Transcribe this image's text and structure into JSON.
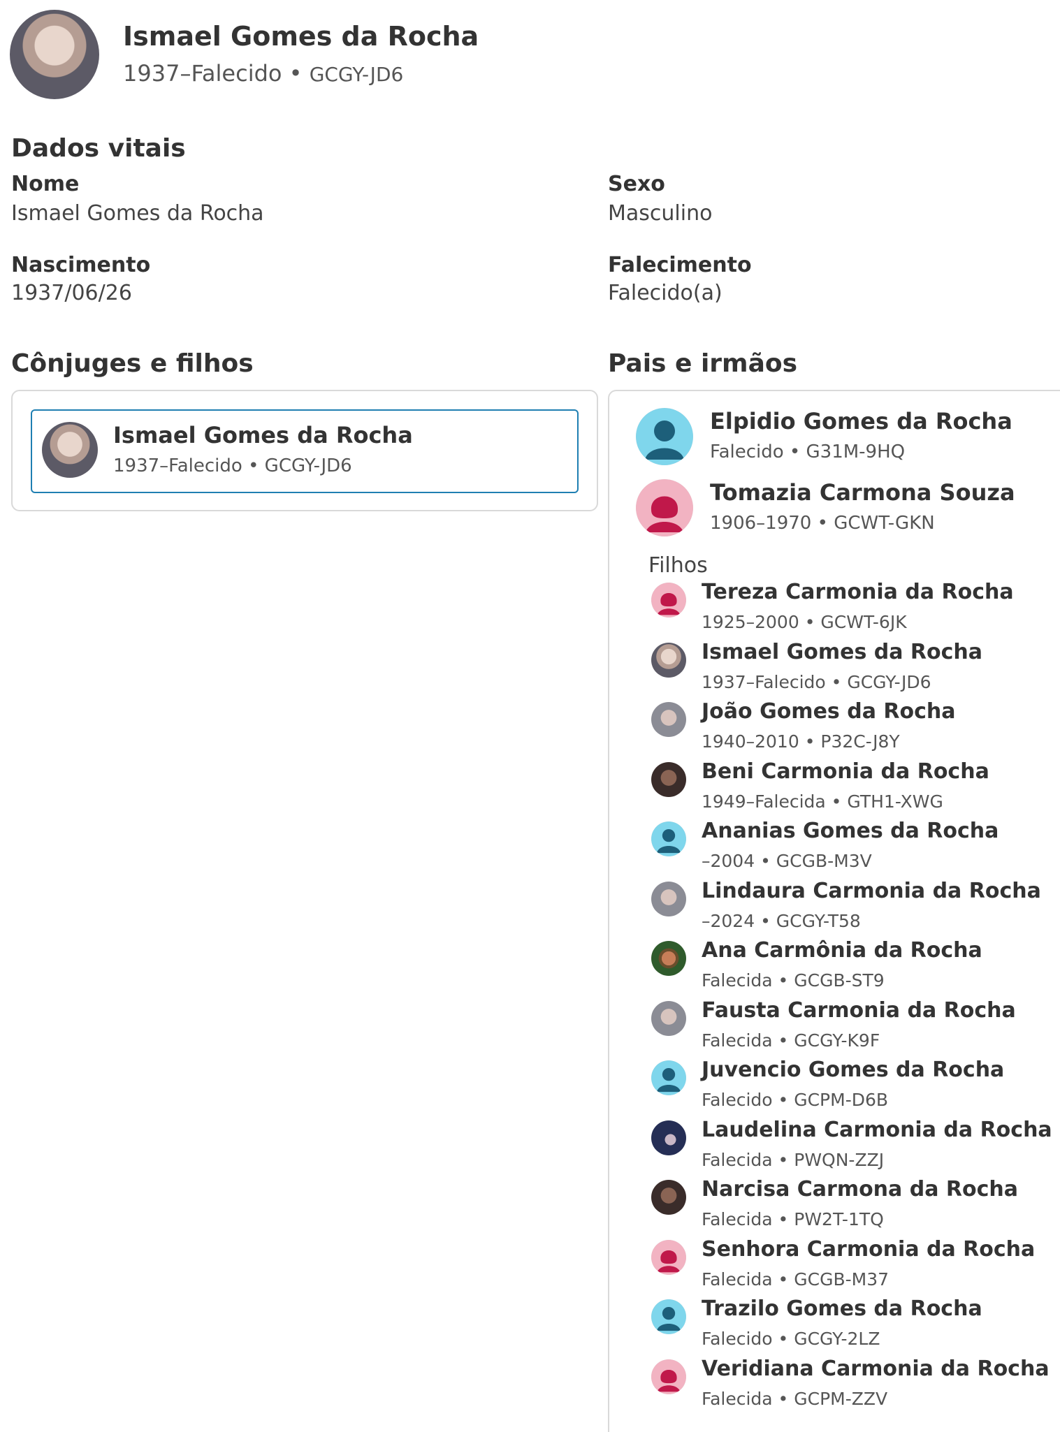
{
  "person": {
    "name": "Ismael Gomes da Rocha",
    "lifespan": "1937–Falecido",
    "id": "GCGY-JD6"
  },
  "vital": {
    "title": "Dados vitais",
    "name_label": "Nome",
    "name_value": "Ismael Gomes da Rocha",
    "sex_label": "Sexo",
    "sex_value": "Masculino",
    "birth_label": "Nascimento",
    "birth_value": "1937/06/26",
    "death_label": "Falecimento",
    "death_value": "Falecido(a)"
  },
  "spouses": {
    "title": "Cônjuges e filhos",
    "card": {
      "name": "Ismael Gomes da Rocha",
      "meta": "1937–Falecido • GCGY-JD6"
    }
  },
  "parents": {
    "title": "Pais e irmãos",
    "father": {
      "name": "Elpidio Gomes da Rocha",
      "meta": "Falecido • G31M-9HQ",
      "icon": "male-silhouette-icon"
    },
    "mother": {
      "name": "Tomazia Carmona Souza",
      "meta": "1906–1970 • GCWT-GKN",
      "icon": "female-silhouette-icon"
    },
    "children_label": "Filhos",
    "children": [
      {
        "name": "Tereza Carmonia da Rocha",
        "meta": "1925–2000 • GCWT-6JK",
        "icon": "female"
      },
      {
        "name": "Ismael Gomes da Rocha",
        "meta": "1937–Falecido • GCGY-JD6",
        "icon": "photo"
      },
      {
        "name": "João Gomes da Rocha",
        "meta": "1940–2010 • P32C-J8Y",
        "icon": "photo-light"
      },
      {
        "name": "Beni Carmonia da Rocha",
        "meta": "1949–Falecida • GTH1-XWG",
        "icon": "photo-dark"
      },
      {
        "name": "Ananias Gomes da Rocha",
        "meta": "–2004 • GCGB-M3V",
        "icon": "male"
      },
      {
        "name": "Lindaura Carmonia da Rocha",
        "meta": "–2024 • GCGY-T58",
        "icon": "photo-light"
      },
      {
        "name": "Ana Carmônia da Rocha",
        "meta": "Falecida • GCGB-ST9",
        "icon": "photo-green"
      },
      {
        "name": "Fausta Carmonia da Rocha",
        "meta": "Falecida • GCGY-K9F",
        "icon": "photo-light"
      },
      {
        "name": "Juvencio Gomes da Rocha",
        "meta": "Falecido • GCPM-D6B",
        "icon": "male"
      },
      {
        "name": "Laudelina Carmonia da Rocha",
        "meta": "Falecida • PWQN-ZZJ",
        "icon": "photo-navy"
      },
      {
        "name": "Narcisa Carmona da Rocha",
        "meta": "Falecida • PW2T-1TQ",
        "icon": "photo-dark"
      },
      {
        "name": "Senhora Carmonia da Rocha",
        "meta": "Falecida • GCGB-M37",
        "icon": "female"
      },
      {
        "name": "Trazilo Gomes da Rocha",
        "meta": "Falecido • GCGY-2LZ",
        "icon": "male"
      },
      {
        "name": "Veridiana Carmonia da Rocha",
        "meta": "Falecida • GCPM-ZZV",
        "icon": "female"
      }
    ]
  },
  "colors": {
    "selected_border": "#1f7fb2",
    "male_bg": "#7fd6ec",
    "male_fg": "#1d5f7a",
    "female_bg": "#f2b3c2",
    "female_fg": "#c0184a"
  }
}
